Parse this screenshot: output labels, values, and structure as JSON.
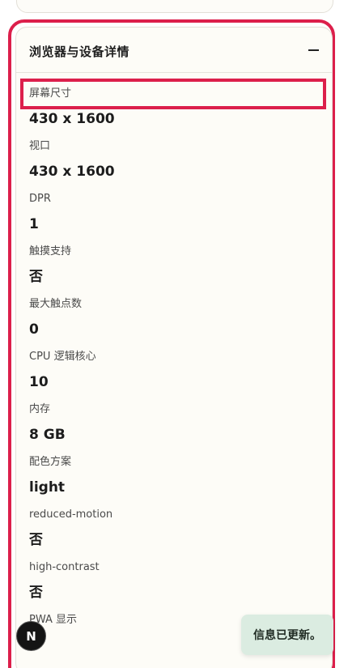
{
  "section": {
    "title": "浏览器与设备详情",
    "collapse_icon": "minus-icon"
  },
  "items": [
    {
      "label": "屏幕尺寸",
      "value": "430 x 1600"
    },
    {
      "label": "视口",
      "value": "430 x 1600"
    },
    {
      "label": "DPR",
      "value": "1"
    },
    {
      "label": "触摸支持",
      "value": "否"
    },
    {
      "label": "最大触点数",
      "value": "0"
    },
    {
      "label": "CPU 逻辑核心",
      "value": "10"
    },
    {
      "label": "内存",
      "value": "8 GB"
    },
    {
      "label": "配色方案",
      "value": "light"
    },
    {
      "label": "reduced-motion",
      "value": "否"
    },
    {
      "label": "high-contrast",
      "value": "否"
    },
    {
      "label": "PWA 显示",
      "value": ""
    }
  ],
  "badge": {
    "letter": "N"
  },
  "toast": {
    "message": "信息已更新。"
  },
  "colors": {
    "highlight": "#dc1f4b",
    "card_background": "#fdfcf7",
    "toast_background": "#dbece1"
  }
}
